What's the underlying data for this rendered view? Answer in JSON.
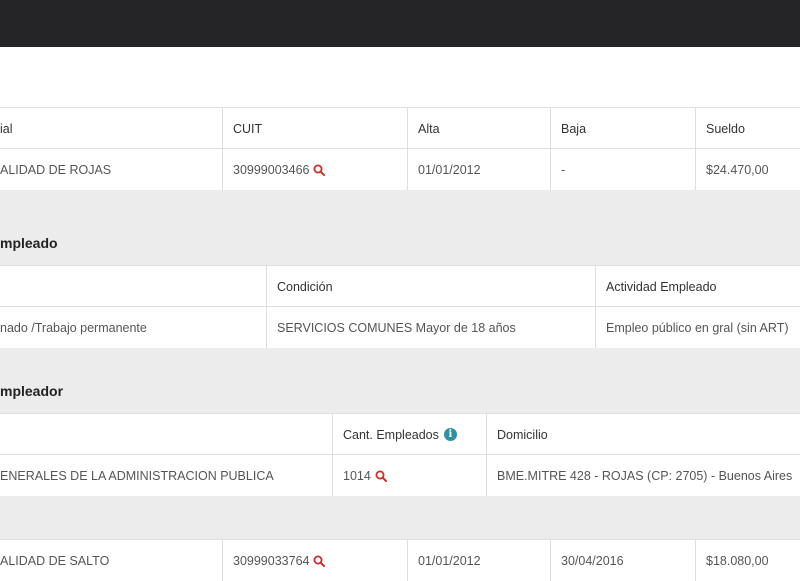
{
  "table1": {
    "headers": [
      "ial",
      "CUIT",
      "Alta",
      "Baja",
      "Sueldo"
    ],
    "row": [
      "ALIDAD DE ROJAS",
      "30999003466",
      "01/01/2012",
      "-",
      "$24.470,00"
    ]
  },
  "empleado_section": {
    "title": "mpleado",
    "headers": [
      "",
      "Condición",
      "Actividad Empleado"
    ],
    "row": [
      "nado /Trabajo permanente",
      "SERVICIOS COMUNES Mayor de 18 años",
      "Empleo público en gral (sin ART)"
    ]
  },
  "empleador_section": {
    "title": "mpleador",
    "headers": [
      "",
      "Cant. Empleados",
      "Domicilio"
    ],
    "row": [
      "ENERALES DE LA ADMINISTRACION PUBLICA",
      "1014",
      "BME.MITRE 428 - ROJAS (CP: 2705) - Buenos Aires"
    ]
  },
  "table2": {
    "row": [
      "ALIDAD DE SALTO",
      "30999033764",
      "01/01/2012",
      "30/04/2016",
      "$18.080,00"
    ]
  },
  "icons": {
    "search": "search-icon",
    "info": "info-icon"
  },
  "colors": {
    "topbar": "#252528",
    "search_icon": "#c9302c",
    "info_icon": "#2f8fa3"
  }
}
